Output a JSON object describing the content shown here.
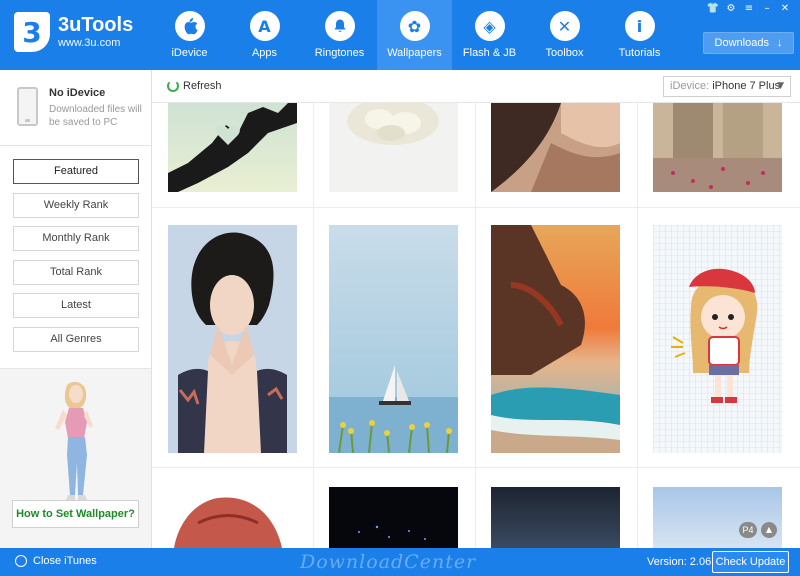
{
  "app": {
    "name": "3uTools",
    "url": "www.3u.com",
    "logo_glyph": "3"
  },
  "nav": [
    {
      "label": "iDevice",
      "glyph": "",
      "icon": "apple-icon"
    },
    {
      "label": "Apps",
      "glyph": "A",
      "icon": "app-store-icon"
    },
    {
      "label": "Ringtones",
      "glyph": "♪",
      "icon": "bell-icon"
    },
    {
      "label": "Wallpapers",
      "glyph": "✿",
      "icon": "flower-icon"
    },
    {
      "label": "Flash & JB",
      "glyph": "◈",
      "icon": "dropbox-icon"
    },
    {
      "label": "Toolbox",
      "glyph": "✕",
      "icon": "tools-icon"
    },
    {
      "label": "Tutorials",
      "glyph": "i",
      "icon": "info-icon"
    }
  ],
  "header": {
    "downloads_label": "Downloads",
    "downloads_icon": "↓"
  },
  "device": {
    "title": "No iDevice",
    "subtitle": "Downloaded files will be saved to PC"
  },
  "ranks": [
    {
      "label": "Featured"
    },
    {
      "label": "Weekly Rank"
    },
    {
      "label": "Monthly Rank"
    },
    {
      "label": "Total Rank"
    },
    {
      "label": "Latest"
    },
    {
      "label": "All Genres"
    }
  ],
  "sidebar": {
    "howto_label": "How to Set Wallpaper?"
  },
  "toolbar": {
    "refresh_label": "Refresh",
    "device_prefix": "iDevice:",
    "device_value": "iPhone 7 Plus"
  },
  "pager": {
    "page_label": "P4"
  },
  "status": {
    "close_itunes_label": "Close iTunes",
    "version_label": "Version: 2.06",
    "check_update_label": "Check Update"
  },
  "watermark": "DownloadCenter",
  "colors": {
    "brand": "#1a7fe8",
    "nav_active": "#3a93f0",
    "howto_green": "#1f8a2c"
  }
}
